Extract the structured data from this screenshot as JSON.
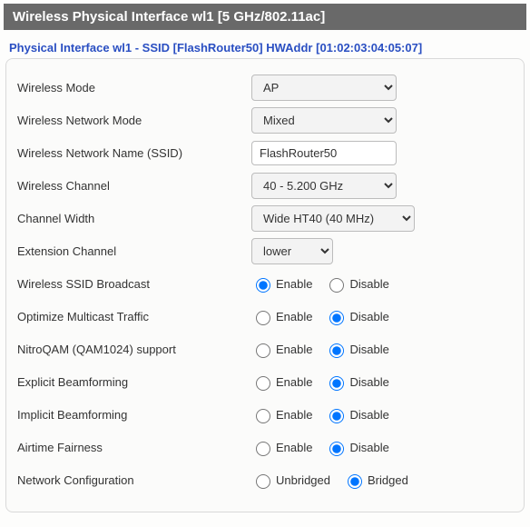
{
  "header": {
    "title": "Wireless Physical Interface wl1 [5 GHz/802.11ac]"
  },
  "subheader": {
    "prefix": "Physical Interface wl1 - SSID [",
    "ssid": "FlashRouter50",
    "mid": "] HWAddr [",
    "hwaddr": "01:02:03:04:05:07",
    "suffix": "]"
  },
  "labels": {
    "wireless_mode": "Wireless Mode",
    "wireless_network_mode": "Wireless Network Mode",
    "ssid": "Wireless Network Name (SSID)",
    "channel": "Wireless Channel",
    "channel_width": "Channel Width",
    "ext_channel": "Extension Channel",
    "ssid_broadcast": "Wireless SSID Broadcast",
    "multicast": "Optimize Multicast Traffic",
    "nitroqam": "NitroQAM (QAM1024) support",
    "explicit_bf": "Explicit Beamforming",
    "implicit_bf": "Implicit Beamforming",
    "airtime": "Airtime Fairness",
    "netconfig": "Network Configuration"
  },
  "values": {
    "wireless_mode": "AP",
    "wireless_network_mode": "Mixed",
    "ssid": "FlashRouter50",
    "channel": "40 - 5.200 GHz",
    "channel_width": "Wide HT40 (40 MHz)",
    "ext_channel": "lower"
  },
  "radio_labels": {
    "enable": "Enable",
    "disable": "Disable",
    "unbridged": "Unbridged",
    "bridged": "Bridged"
  },
  "radio_state": {
    "ssid_broadcast": "enable",
    "multicast": "disable",
    "nitroqam": "disable",
    "explicit_bf": "disable",
    "implicit_bf": "disable",
    "airtime": "disable",
    "netconfig": "bridged"
  }
}
